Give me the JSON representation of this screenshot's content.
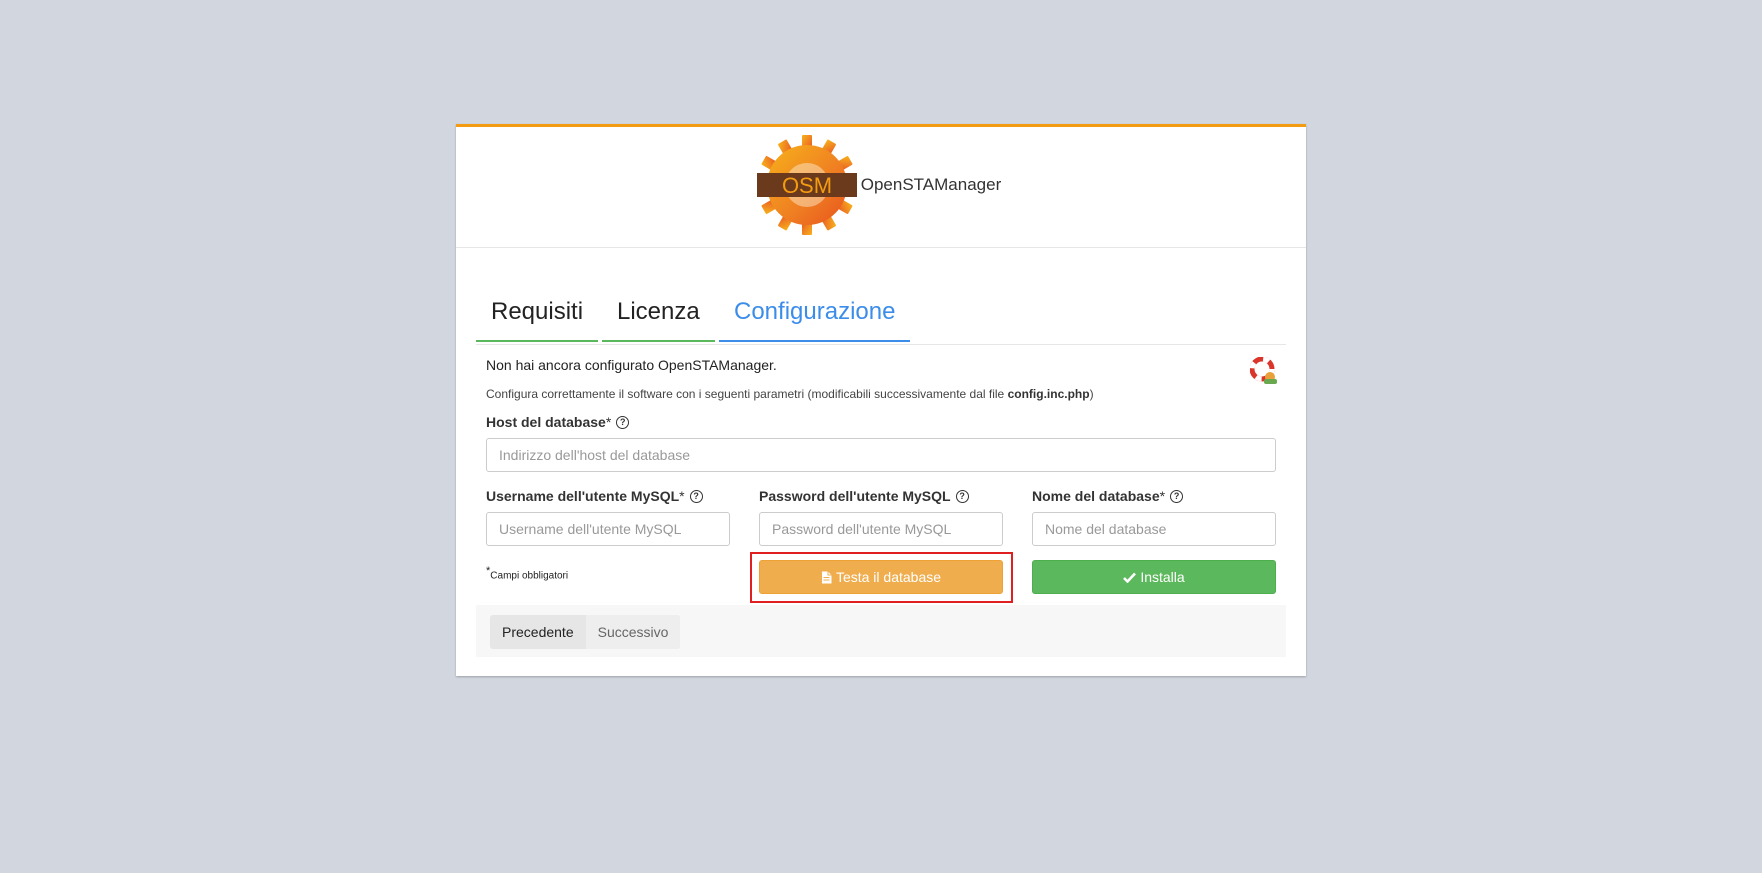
{
  "header": {
    "logo_text": "OSM",
    "brand": "OpenSTAManager"
  },
  "tabs": [
    {
      "label": "Requisiti"
    },
    {
      "label": "Licenza"
    },
    {
      "label": "Configurazione",
      "active": true
    }
  ],
  "intro": {
    "title": "Non hai ancora configurato OpenSTAManager.",
    "description_prefix": "Configura correttamente il software con i seguenti parametri (modificabili successivamente dal file ",
    "description_file": "config.inc.php",
    "description_suffix": ")"
  },
  "form": {
    "host": {
      "label": "Host del database",
      "required_mark": "*",
      "placeholder": "Indirizzo dell'host del database",
      "value": ""
    },
    "username": {
      "label": "Username dell'utente MySQL",
      "required_mark": "*",
      "placeholder": "Username dell'utente MySQL",
      "value": ""
    },
    "password": {
      "label": "Password dell'utente MySQL",
      "required_mark": "",
      "placeholder": "Password dell'utente MySQL",
      "value": ""
    },
    "dbname": {
      "label": "Nome del database",
      "required_mark": "*",
      "placeholder": "Nome del database",
      "value": ""
    },
    "help_glyph": "?"
  },
  "note": {
    "mark": "*",
    "text": "Campi obbligatori"
  },
  "buttons": {
    "test": "Testa il database",
    "install": "Installa"
  },
  "pager": {
    "prev": "Precedente",
    "next": "Successivo"
  },
  "colors": {
    "background": "#d2d6de",
    "accent_top": "#f39c12",
    "tab_done": "#5cb85c",
    "tab_active": "#3c8dea",
    "warning": "#f0ad4e",
    "success": "#5cb85c",
    "highlight": "#e02020"
  }
}
